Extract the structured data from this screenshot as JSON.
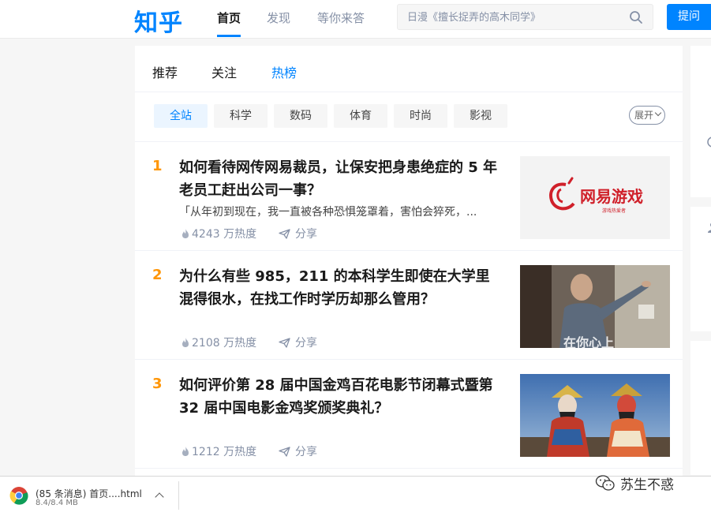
{
  "header": {
    "logo": "知乎",
    "nav": [
      {
        "label": "首页",
        "active": true
      },
      {
        "label": "发现",
        "active": false
      },
      {
        "label": "等你来答",
        "active": false
      }
    ],
    "search_placeholder": "日漫《擅长捉弄的高木同学》",
    "search_icon": "search-icon",
    "ask_label": "提问"
  },
  "tabs": [
    {
      "label": "推荐",
      "active": false
    },
    {
      "label": "关注",
      "active": false
    },
    {
      "label": "热榜",
      "active": true
    }
  ],
  "filters": [
    "全站",
    "科学",
    "数码",
    "体育",
    "时尚",
    "影视"
  ],
  "expand_label": "展开",
  "hot_list": [
    {
      "rank": "1",
      "title": "如何看待网传网易裁员，让保安把身患绝症的 5 年老员工赶出公司一事？",
      "excerpt": "「从年初到现在，我一直被各种恐惧笼罩着，害怕会猝死，...",
      "heat": "4243 万热度",
      "share": "分享",
      "thumb_text": "网易游戏",
      "thumb_sub": "游戏热爱者"
    },
    {
      "rank": "2",
      "title": "为什么有些 985，211 的本科学生即使在大学里混得很水，在找工作时学历却那么管用？",
      "excerpt": "",
      "heat": "2108 万热度",
      "share": "分享",
      "thumb_text": "在你心上",
      "thumb_sub": ""
    },
    {
      "rank": "3",
      "title": "如何评价第 28 届中国金鸡百花电影节闭幕式暨第 32 届中国电影金鸡奖颁奖典礼？",
      "excerpt": "",
      "heat": "1212 万热度",
      "share": "分享",
      "thumb_text": "",
      "thumb_sub": ""
    }
  ],
  "download": {
    "name": "(85 条消息) 首页....html",
    "size": "8.4/8.4 MB"
  },
  "watermark": "苏生不惑",
  "colors": {
    "brand": "#0084ff",
    "rank": "#ff9607",
    "muted": "#8590a6"
  }
}
